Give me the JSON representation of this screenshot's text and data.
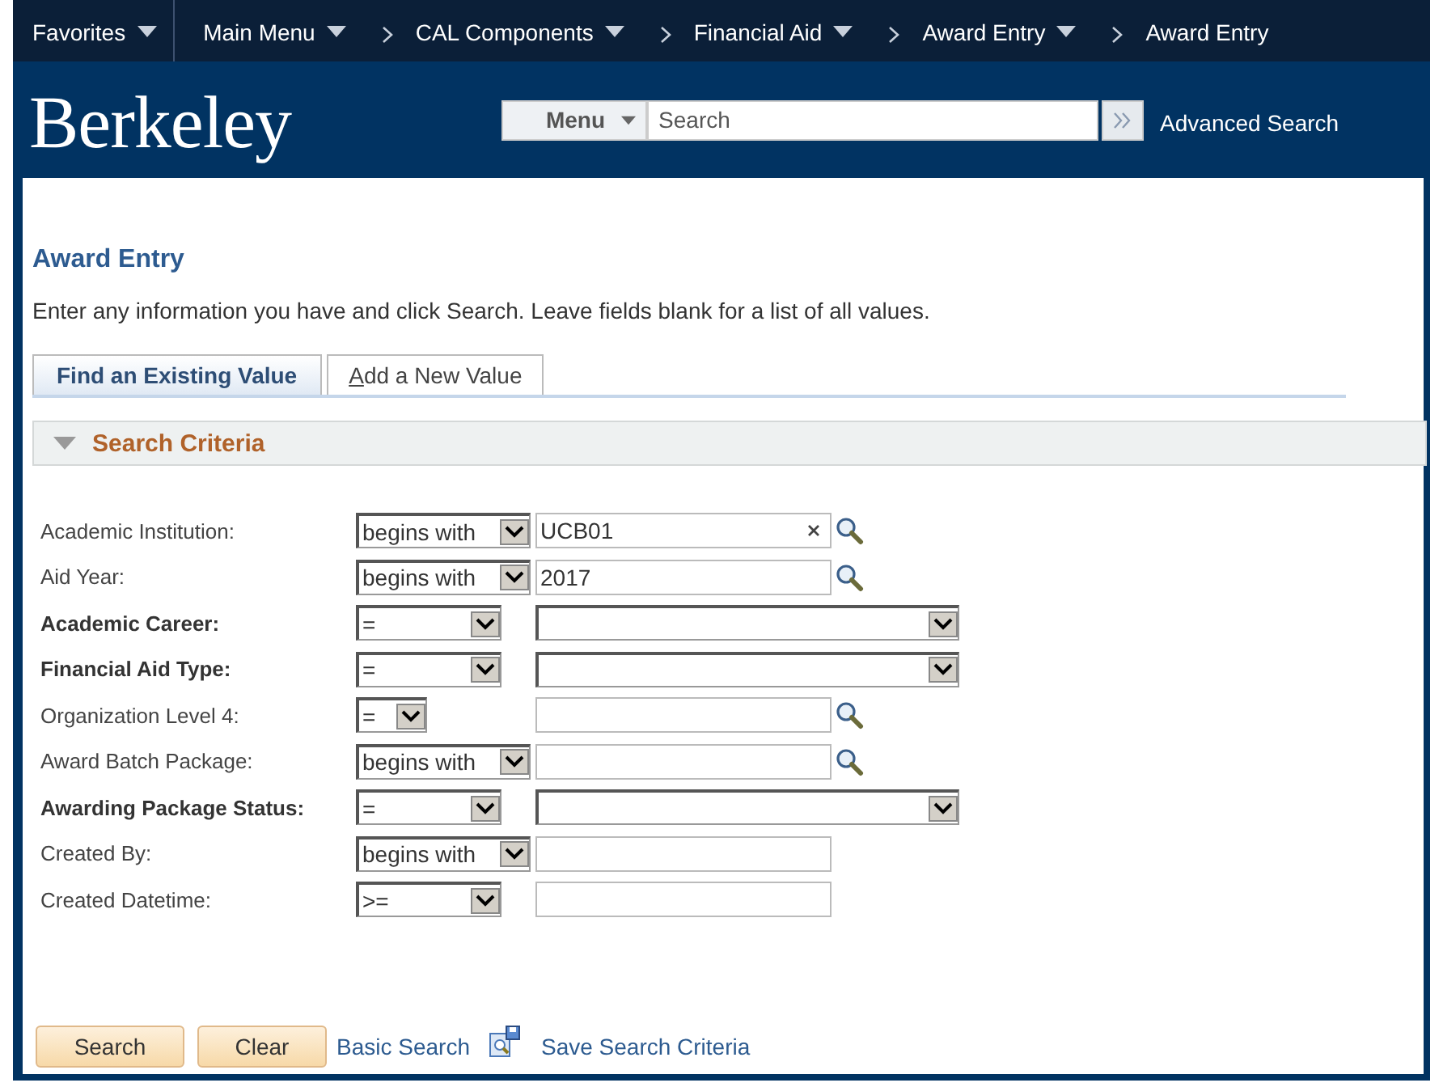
{
  "nav": {
    "items": [
      {
        "label": "Favorites",
        "kind": "menu"
      },
      {
        "label": "Main Menu",
        "kind": "menu"
      },
      {
        "label": "CAL Components",
        "kind": "crumb"
      },
      {
        "label": "Financial Aid",
        "kind": "crumb"
      },
      {
        "label": "Award Entry",
        "kind": "crumb"
      },
      {
        "label": "Award Entry",
        "kind": "current"
      }
    ]
  },
  "banner": {
    "logo": "Berkeley",
    "menu_button": "Menu",
    "search_placeholder": "Search",
    "advanced_link": "Advanced Search"
  },
  "page": {
    "title": "Award Entry",
    "instructions": "Enter any information you have and click Search. Leave fields blank for a list of all values.",
    "tabs": [
      {
        "label": "Find an Existing Value",
        "selected": true
      },
      {
        "label": "Add a New Value",
        "selected": false
      }
    ],
    "section": {
      "title": "Search Criteria",
      "expanded": true
    },
    "criteria": [
      {
        "label": "Academic Institution:",
        "required": false,
        "operator": {
          "text": "begins with",
          "kind": "wide"
        },
        "field": {
          "kind": "lookup",
          "value": "UCB01",
          "clearable": true
        }
      },
      {
        "label": "Aid Year:",
        "required": false,
        "operator": {
          "text": "begins with",
          "kind": "wide"
        },
        "field": {
          "kind": "lookup",
          "value": "2017",
          "clearable": false
        }
      },
      {
        "label": "Academic Career:",
        "required": true,
        "operator": {
          "text": "=",
          "kind": "medium"
        },
        "field": {
          "kind": "select"
        }
      },
      {
        "label": "Financial Aid Type:",
        "required": true,
        "operator": {
          "text": "=",
          "kind": "medium"
        },
        "field": {
          "kind": "select"
        }
      },
      {
        "label": "Organization Level 4:",
        "required": false,
        "operator": {
          "text": "=",
          "kind": "tiny"
        },
        "field": {
          "kind": "lookup",
          "clearable": false
        }
      },
      {
        "label": "Award Batch Package:",
        "required": false,
        "operator": {
          "text": "begins with",
          "kind": "wide"
        },
        "field": {
          "kind": "lookup",
          "clearable": false
        }
      },
      {
        "label": "Awarding Package Status:",
        "required": true,
        "operator": {
          "text": "=",
          "kind": "medium"
        },
        "field": {
          "kind": "select"
        }
      },
      {
        "label": "Created By:",
        "required": false,
        "operator": {
          "text": "begins with",
          "kind": "wide"
        },
        "field": {
          "kind": "text",
          "clearable": false
        }
      },
      {
        "label": "Created Datetime:",
        "required": false,
        "operator": {
          "text": ">=",
          "kind": "medium"
        },
        "field": {
          "kind": "text",
          "clearable": false
        }
      }
    ],
    "buttons": [
      {
        "label": "Search",
        "kind": "button"
      },
      {
        "label": "Clear",
        "kind": "button"
      },
      {
        "label": "Basic Search",
        "kind": "link"
      },
      {
        "label": "Save Search Criteria",
        "kind": "save-link"
      }
    ]
  }
}
